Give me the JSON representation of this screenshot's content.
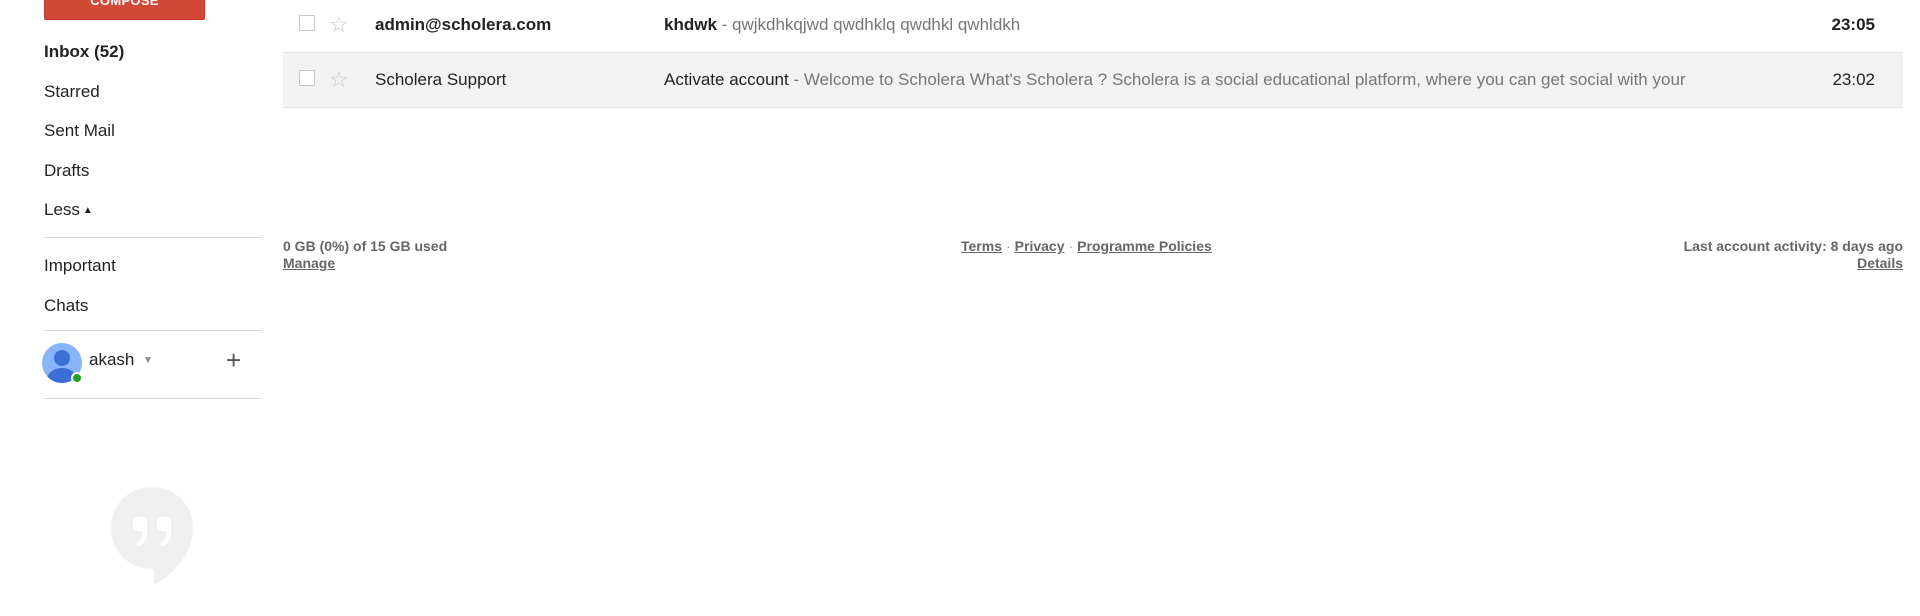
{
  "sidebar": {
    "compose_label": "COMPOSE",
    "items": [
      {
        "label": "Inbox (52)"
      },
      {
        "label": "Starred"
      },
      {
        "label": "Sent Mail"
      },
      {
        "label": "Drafts"
      },
      {
        "label": "Less"
      }
    ],
    "items_secondary": [
      {
        "label": "Important"
      },
      {
        "label": "Chats"
      }
    ],
    "user": {
      "name": "akash",
      "status_color": "#20a520"
    },
    "add_icon": "plus-icon",
    "hangouts_icon": "hangouts-quote-icon"
  },
  "mail_list": {
    "rows": [
      {
        "sender": "admin@scholera.com",
        "subject": "khdwk",
        "snippet": " - qwjkdhkqjwd qwdhklq qwdhkl qwhldkh",
        "time": "23:05",
        "unread": true
      },
      {
        "sender": "Scholera Support",
        "subject": "Activate account",
        "snippet": " - Welcome to Scholera What's Scholera ? Scholera is a social educational platform, where you can get social with your",
        "time": "23:02",
        "unread": false
      }
    ]
  },
  "footer": {
    "storage_text": "0 GB (0%) of 15 GB used",
    "manage_label": "Manage",
    "terms_label": "Terms",
    "privacy_label": "Privacy",
    "policies_label": "Programme Policies",
    "separator": "·",
    "activity_text": "Last account activity: 8 days ago",
    "details_label": "Details"
  },
  "colors": {
    "compose": "#d14836",
    "read_row": "#f2f2f2",
    "snippet": "#777777"
  }
}
